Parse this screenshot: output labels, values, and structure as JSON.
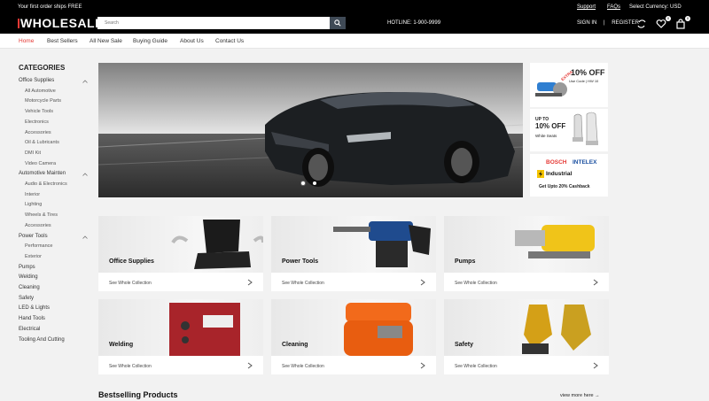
{
  "topbar": {
    "promo": "Your first order ships FREE",
    "logo": "WHOLESALE",
    "search_placeholder": "Search",
    "hotline": "HOTLINE: 1-900-9999",
    "support": "Support",
    "faqs": "FAQs",
    "currency": "Select Currency: USD",
    "signin": "SIGN IN",
    "separator": "|",
    "register": "REGISTER",
    "wishlist_count": "0",
    "cart_count": "0"
  },
  "nav": {
    "items": [
      "Home",
      "Best Sellers",
      "All New Sale",
      "Buying Guide",
      "About Us",
      "Contact Us"
    ]
  },
  "sidebar": {
    "title": "CATEGORIES",
    "items": [
      {
        "label": "Office Supplies",
        "type": "main"
      },
      {
        "label": "All Automotive",
        "type": "sub"
      },
      {
        "label": "Motorcycle Parts",
        "type": "sub"
      },
      {
        "label": "Vehicle Tools",
        "type": "sub"
      },
      {
        "label": "Electronics",
        "type": "sub"
      },
      {
        "label": "Accessories",
        "type": "sub"
      },
      {
        "label": "Oil & Lubricants",
        "type": "sub"
      },
      {
        "label": "DMI Kit",
        "type": "sub"
      },
      {
        "label": "Video Camera",
        "type": "sub"
      },
      {
        "label": "Automotive Mainten",
        "type": "main"
      },
      {
        "label": "Audio & Electronics",
        "type": "sub"
      },
      {
        "label": "Interior",
        "type": "sub"
      },
      {
        "label": "Lighting",
        "type": "sub"
      },
      {
        "label": "Wheels & Tires",
        "type": "sub"
      },
      {
        "label": "Accessories",
        "type": "sub"
      },
      {
        "label": "Power Tools",
        "type": "main"
      },
      {
        "label": "Performance",
        "type": "sub"
      },
      {
        "label": "Exterior",
        "type": "sub"
      },
      {
        "label": "Pumps",
        "type": "main"
      },
      {
        "label": "Welding",
        "type": "main"
      },
      {
        "label": "Cleaning",
        "type": "main"
      },
      {
        "label": "Safety",
        "type": "main"
      },
      {
        "label": "LED & Lights",
        "type": "main"
      },
      {
        "label": "Hand Tools",
        "type": "main"
      },
      {
        "label": "Electrical",
        "type": "main"
      },
      {
        "label": "Tooling And Cutting",
        "type": "main"
      }
    ]
  },
  "banners": {
    "b1": {
      "extra": "EXTRA",
      "off": "10% OFF",
      "code": "Use Code | HW 10"
    },
    "b2": {
      "upto": "UP TO",
      "off": "10% OFF",
      "sub": "White Seats"
    },
    "b3": {
      "brand1": "BOSCH",
      "brand2": "INTELEX",
      "brand3": "Industrial",
      "cashback": "Get Upto 20% Cashback"
    }
  },
  "cards": [
    {
      "name": "Office Supplies",
      "link": "See Whole Collection"
    },
    {
      "name": "Power Tools",
      "link": "See Whole Collection"
    },
    {
      "name": "Pumps",
      "link": "See Whole Collection"
    },
    {
      "name": "Welding",
      "link": "See Whole Collection"
    },
    {
      "name": "Cleaning",
      "link": "See Whole Collection"
    },
    {
      "name": "Safety",
      "link": "See Whole Collection"
    }
  ],
  "bestselling": {
    "title": "Bestselling Products",
    "viewmore": "view more here"
  },
  "colors": {
    "accent": "#e53935",
    "topbar": "#000000",
    "search_button": "#3f4a56"
  }
}
